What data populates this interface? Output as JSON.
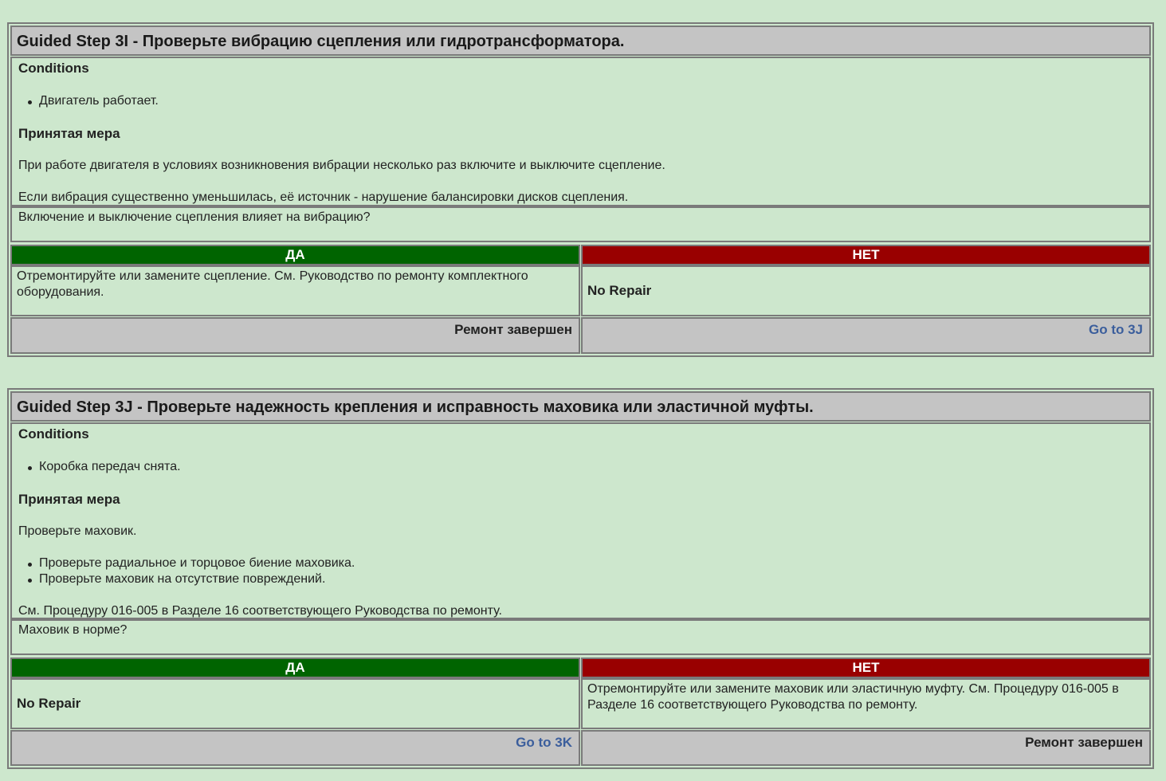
{
  "steps": [
    {
      "title": "Guided Step 3I - Проверьте вибрацию сцепления или гидротрансформатора.",
      "conditions_label": "Conditions",
      "conditions": [
        "Двигатель работает."
      ],
      "action_label": "Принятая мера",
      "action_paragraph1": "При работе двигателя в условиях возникновения вибрации несколько раз включите и выключите сцепление.",
      "action_paragraph2": "Если вибрация существенно уменьшилась, её источник - нарушение балансировки дисков сцепления.",
      "question": "Включение и выключение сцепления влияет на вибрацию?",
      "yes_label": "ДА",
      "no_label": "НЕТ",
      "yes_result": "Отремонтируйте или замените сцепление. См. Руководство по ремонту комплектного оборудования.",
      "no_result": "No Repair",
      "yes_footer": "Ремонт завершен",
      "no_footer_link": "Go to 3J"
    },
    {
      "title": "Guided Step 3J - Проверьте надежность крепления и исправность маховика или эластичной муфты.",
      "conditions_label": "Conditions",
      "conditions": [
        "Коробка передач снята."
      ],
      "action_label": "Принятая мера",
      "action_paragraph1": "Проверьте маховик.",
      "action_bullets": [
        "Проверьте радиальное и торцовое биение маховика.",
        "Проверьте маховик на отсутствие повреждений."
      ],
      "action_paragraph2": "См. Процедуру 016-005 в Разделе 16 соответствующего Руководства по ремонту.",
      "question": "Маховик в норме?",
      "yes_label": "ДА",
      "no_label": "НЕТ",
      "yes_result": "No Repair",
      "no_result": "Отремонтируйте или замените маховик или эластичную муфту. См. Процедуру 016-005 в Разделе 16 соответствующего Руководства по ремонту.",
      "yes_footer_link": "Go to 3K",
      "no_footer": "Ремонт завершен"
    }
  ],
  "colors": {
    "background": "#cde7cd",
    "header_gray": "#c4c4c4",
    "yes_green": "#006400",
    "no_red": "#990000",
    "link_blue": "#3b5e9c"
  }
}
